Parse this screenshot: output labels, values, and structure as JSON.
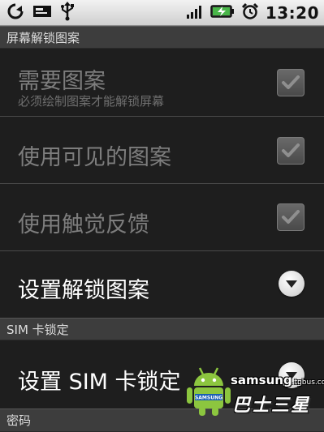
{
  "status_bar": {
    "time": "13:20",
    "icons": [
      "sync-icon",
      "message-icon",
      "usb-icon",
      "signal-icon",
      "battery-charging-icon",
      "alarm-icon"
    ]
  },
  "sections": {
    "pattern": {
      "header": "屏幕解锁图案"
    },
    "sim": {
      "header": "SIM 卡锁定"
    },
    "password": {
      "header": "密码"
    }
  },
  "prefs": {
    "require_pattern": {
      "title": "需要图案",
      "summary": "必须绘制图案才能解锁屏幕",
      "checked": true,
      "enabled": false
    },
    "visible_pattern": {
      "title": "使用可见的图案",
      "checked": true,
      "enabled": false
    },
    "tactile_feedback": {
      "title": "使用触觉反馈",
      "checked": true,
      "enabled": false
    },
    "set_unlock_pattern": {
      "title": "设置解锁图案"
    },
    "set_sim_lock": {
      "title": "设置 SIM 卡锁定"
    }
  },
  "watermark": {
    "domain": "samsung",
    "domain_suffix": ".tgbus.com",
    "cn": "巴士三星",
    "logo_text": "SAMSUNG"
  },
  "colors": {
    "background": "#1e1e1e",
    "section_header": "#3d3d3d",
    "text_enabled": "#ffffff",
    "text_disabled": "#7d7d7d",
    "android_green": "#8cc63f"
  }
}
